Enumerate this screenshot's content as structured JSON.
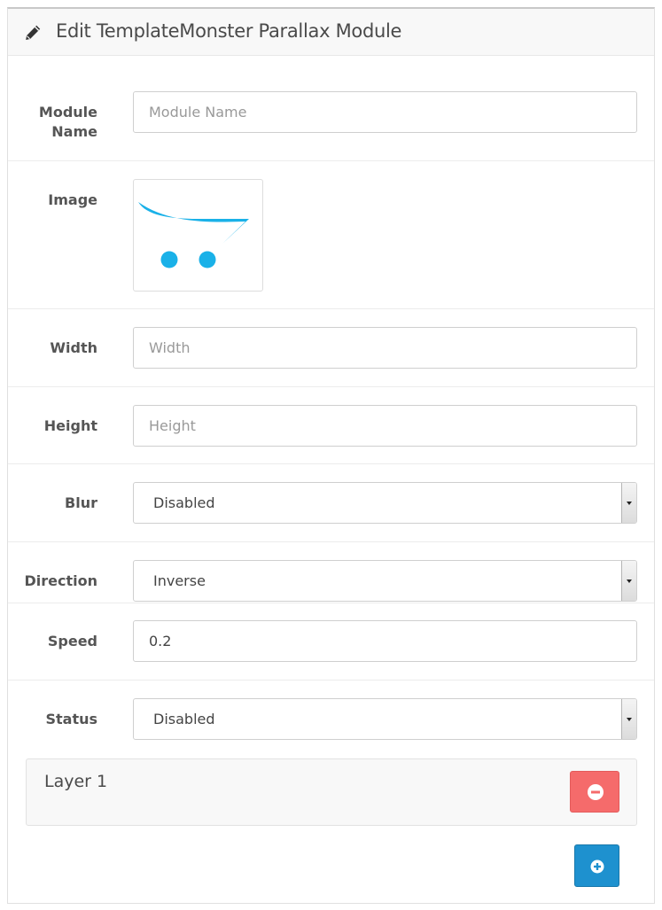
{
  "header": {
    "title": "Edit TemplateMonster Parallax Module",
    "icon": "pencil-icon"
  },
  "form": {
    "module_name": {
      "label": "Module Name",
      "placeholder": "Module Name",
      "value": ""
    },
    "image": {
      "label": "Image",
      "icon": "opencart-cart-logo"
    },
    "width": {
      "label": "Width",
      "placeholder": "Width",
      "value": ""
    },
    "height": {
      "label": "Height",
      "placeholder": "Height",
      "value": ""
    },
    "blur": {
      "label": "Blur",
      "value": "Disabled"
    },
    "direction": {
      "label": "Direction",
      "value": "Inverse"
    },
    "speed": {
      "label": "Speed",
      "value": "0.2"
    },
    "status": {
      "label": "Status",
      "value": "Disabled"
    }
  },
  "layers": [
    {
      "title": "Layer 1",
      "remove_icon": "minus-circle-icon"
    }
  ],
  "add_layer": {
    "icon": "plus-circle-icon"
  },
  "colors": {
    "danger": "#f56b6b",
    "primary": "#1e91cf",
    "logo": "#1ab1e8"
  }
}
